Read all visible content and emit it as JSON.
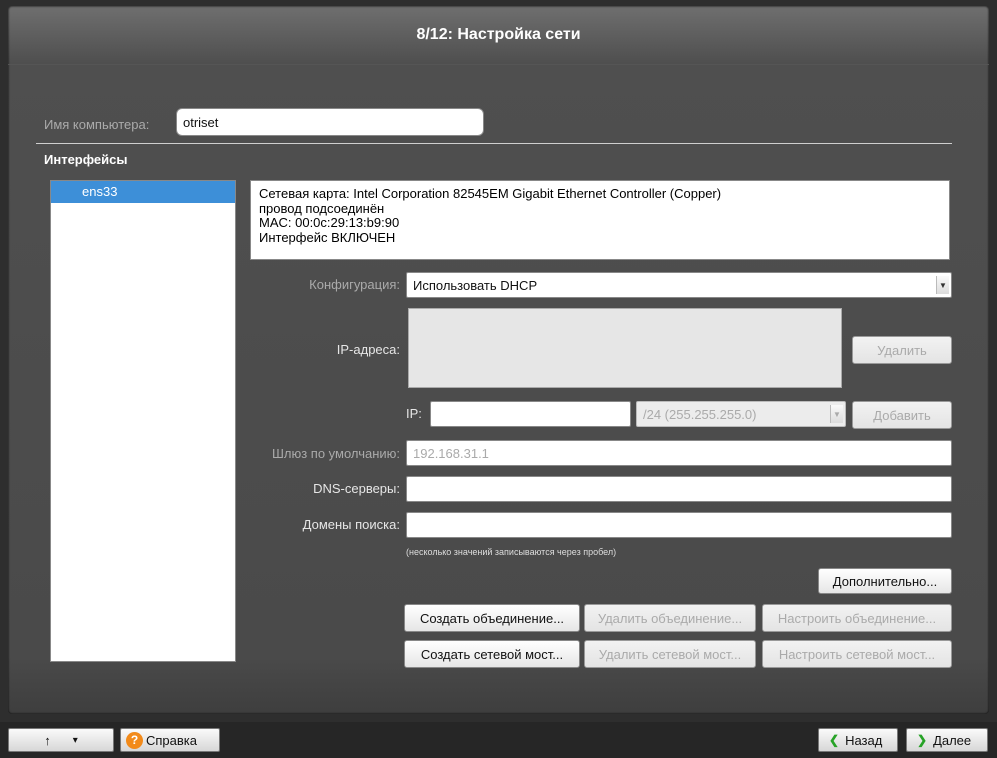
{
  "title": "8/12: Настройка сети",
  "hostname": {
    "label": "Имя компьютера:",
    "value": "otriset"
  },
  "interfaces": {
    "heading": "Интерфейсы",
    "items": [
      "ens33"
    ],
    "info": [
      "Сетевая карта: Intel Corporation 82545EM Gigabit Ethernet Controller (Copper)",
      "провод подсоединён",
      "MAC: 00:0c:29:13:b9:90",
      "Интерфейс ВКЛЮЧЕН"
    ]
  },
  "config": {
    "label": "Конфигурация:",
    "value": "Использовать DHCP"
  },
  "ip": {
    "list_label": "IP-адреса:",
    "delete_label": "Удалить",
    "ip_label": "IP:",
    "ip_value": "",
    "mask_value": "/24 (255.255.255.0)",
    "add_label": "Добавить"
  },
  "gateway": {
    "label": "Шлюз по умолчанию:",
    "placeholder": "192.168.31.1"
  },
  "dns": {
    "label": "DNS-серверы:",
    "value": ""
  },
  "domains": {
    "label": "Домены поиска:",
    "value": ""
  },
  "hint": "(несколько значений записываются через пробел)",
  "buttons": {
    "advanced": "Дополнительно...",
    "create_bond": "Создать объединение...",
    "delete_bond": "Удалить объединение...",
    "setup_bond": "Настроить объединение...",
    "create_bridge": "Создать сетевой мост...",
    "delete_bridge": "Удалить сетевой мост...",
    "setup_bridge": "Настроить сетевой мост..."
  },
  "bottom": {
    "up_icon": "↑",
    "dropdown_icon": "▾",
    "help_icon": "?",
    "help_label": "Справка",
    "back_icon": "❮",
    "back_label": "Назад",
    "next_icon": "❯",
    "next_label": "Далее"
  },
  "colors": {
    "selection": "#3d8fd8",
    "help_icon": "#f28a1a",
    "nav_arrow": "#27a327"
  }
}
